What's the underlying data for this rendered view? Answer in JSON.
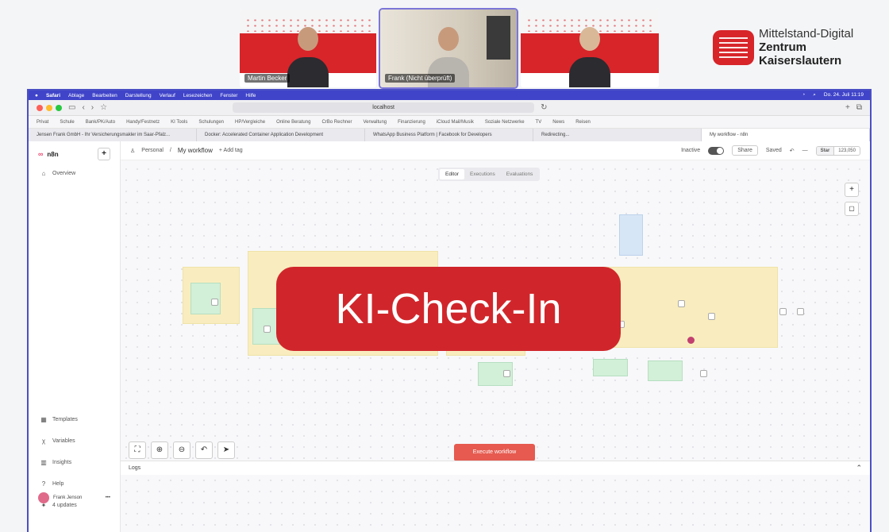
{
  "participants": [
    {
      "name": "Martin Becker",
      "active": false
    },
    {
      "name": "Frank (Nicht überprüft)",
      "active": true
    },
    {
      "name": "",
      "active": false
    }
  ],
  "logo": {
    "line1": "Mittelstand-Digital",
    "line2": "Zentrum",
    "line3": "Kaiserslautern"
  },
  "menubar": {
    "items": [
      "Safari",
      "Ablage",
      "Bearbeiten",
      "Darstellung",
      "Verlauf",
      "Lesezeichen",
      "Fenster",
      "Hilfe"
    ],
    "clock": "Do. 24. Juli 11:19"
  },
  "browser": {
    "url": "localhost",
    "bookmarks": [
      "Privat",
      "Schule",
      "Bank/PK/Auto",
      "Handy/Festnetz",
      "KI Tools",
      "Schulungen",
      "HP/Vergleiche",
      "Online Beratung",
      "CrBo Rechner",
      "Verwaltung",
      "Finanzierung",
      "iCloud Mail/Musik",
      "Soziale Netzwerke",
      "TV",
      "News",
      "Reisen"
    ],
    "tabs": [
      "Jensen Frank GmbH - Ihr Versicherungsmakler im Saar-Pfalz...",
      "Docker: Accelerated Container Application Development",
      "WhatsApp Business Platform | Facebook for Developers",
      "Redirecting...",
      "My workflow - n8n"
    ]
  },
  "n8n": {
    "brand": "n8n",
    "sidebar_top": [
      {
        "icon": "house-icon",
        "glyph": "⌂",
        "label": "Overview"
      }
    ],
    "sidebar_bottom": [
      {
        "icon": "templates-icon",
        "glyph": "▦",
        "label": "Templates"
      },
      {
        "icon": "variables-icon",
        "glyph": "χ",
        "label": "Variables"
      },
      {
        "icon": "insights-icon",
        "glyph": "▥",
        "label": "Insights"
      },
      {
        "icon": "help-icon",
        "glyph": "?",
        "label": "Help"
      },
      {
        "icon": "updates-icon",
        "glyph": "✦",
        "label": "4 updates"
      }
    ],
    "user": "Frank Jenson",
    "breadcrumb_project": "Personal",
    "workflow_name": "My workflow",
    "add_tag": "+ Add tag",
    "status": "Inactive",
    "share": "Share",
    "saved": "Saved",
    "star_label": "Star",
    "star_count": "123,050",
    "tabs": [
      "Editor",
      "Executions",
      "Evaluations"
    ],
    "execute": "Execute workflow",
    "logs": "Logs"
  },
  "overlay_text": "KI-Check-In",
  "colors": {
    "brand_red": "#d0262b",
    "share_border": "#4b4fc4",
    "execute": "#e65a4f"
  }
}
